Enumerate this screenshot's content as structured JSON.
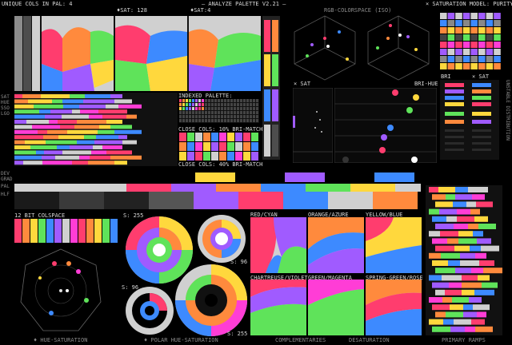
{
  "header": {
    "unique_cols": "UNIQUE COLS IN PAL: 4",
    "title": "– ANALYZE PALETTE V2.21 –",
    "saturation_model": "× SATURATION MODEL: PURITY",
    "sat_label": "♦SAT: 128",
    "sat2_label": "♦SAT:4",
    "space_label": "RGB-COLORSPACE (ISO)"
  },
  "panels": {
    "indexed_palette": "INDEXED PALETTE:",
    "close_cols_a": "CLOSE COLS: 10% BRI-MATCH",
    "close_cols_b": "CLOSE COLS: 40% BRI-MATCH",
    "sat_axis": "× SAT",
    "bri_hue": "BRI-HUE",
    "bri": "BRI",
    "sat_right": "× SAT",
    "bit_colspace": "12 BIT COLSPACE",
    "s255_a": "S: 255",
    "s96_a": "S: 96",
    "s96_b": "S: 96",
    "s255_b": "S: 255"
  },
  "complementaries": {
    "red_cyan": "RED/CYAN",
    "orange_azure": "ORANGE/AZURE",
    "yellow_blue": "YELLOW/BLUE",
    "chartreuse_violet": "CHARTREUSE/VIOLET",
    "green_magenta": "GREEN/MAGENTA",
    "spring_rose": "SPRING-GREEN/ROSE"
  },
  "footer": {
    "hue_saturation": "♦ HUE-SATURATION",
    "polar": "♦ POLAR HUE-SATURATION",
    "complementaries": "COMPLEMENTARIES",
    "desaturation": "DESATURATION",
    "primary_ramps": "PRIMARY RAMPS"
  },
  "left_side_labels": [
    "SAT",
    "HUE",
    "SSO",
    "LGO"
  ],
  "left_side_labels_b": [
    "DEV",
    "GRAD",
    "PAL",
    "HLF"
  ],
  "right_side_text": "UNSTABLE DISTRIBUTION",
  "palette": {
    "red": "#ff3d6e",
    "orange": "#ff8a3d",
    "yellow": "#ffd83d",
    "green": "#5fe35a",
    "blue": "#3d8aff",
    "violet": "#a05bff",
    "magenta": "#ff3dd6",
    "grey": "#d0d0d0",
    "white": "#ffffff"
  }
}
